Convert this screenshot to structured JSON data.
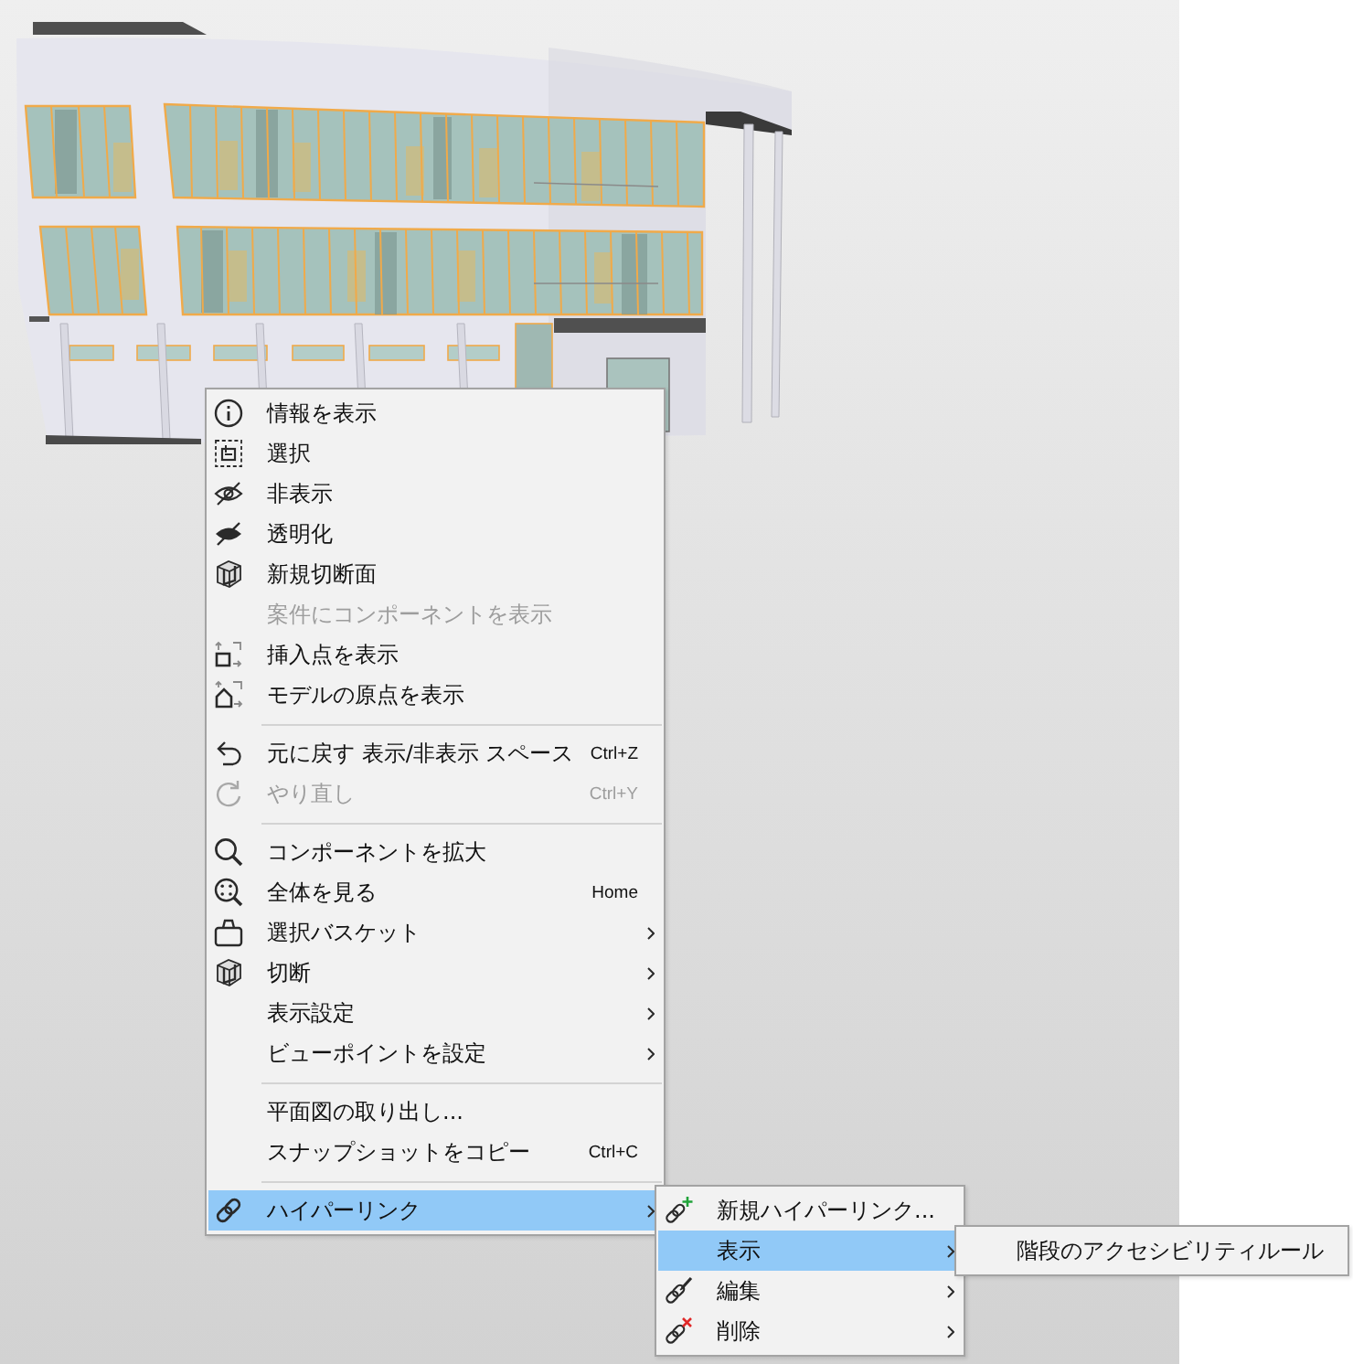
{
  "context_menu": {
    "groups": [
      {
        "items": [
          {
            "label": "情報を表示",
            "disabled": false,
            "selected": false,
            "has_submenu": false
          },
          {
            "label": "選択",
            "disabled": false,
            "selected": false,
            "has_submenu": false
          },
          {
            "label": "非表示",
            "disabled": false,
            "selected": false,
            "has_submenu": false
          },
          {
            "label": "透明化",
            "disabled": false,
            "selected": false,
            "has_submenu": false
          },
          {
            "label": "新規切断面",
            "disabled": false,
            "selected": false,
            "has_submenu": false
          },
          {
            "label": "案件にコンポーネントを表示",
            "disabled": true,
            "selected": false,
            "has_submenu": false
          },
          {
            "label": "挿入点を表示",
            "disabled": false,
            "selected": false,
            "has_submenu": false
          },
          {
            "label": "モデルの原点を表示",
            "disabled": false,
            "selected": false,
            "has_submenu": false
          }
        ]
      },
      {
        "items": [
          {
            "label": "元に戻す 表示/非表示 スペース",
            "shortcut": "Ctrl+Z",
            "disabled": false,
            "selected": false,
            "has_submenu": false
          },
          {
            "label": "やり直し",
            "shortcut": "Ctrl+Y",
            "disabled": true,
            "selected": false,
            "has_submenu": false
          }
        ]
      },
      {
        "items": [
          {
            "label": "コンポーネントを拡大",
            "disabled": false,
            "selected": false,
            "has_submenu": false
          },
          {
            "label": "全体を見る",
            "shortcut": "Home",
            "disabled": false,
            "selected": false,
            "has_submenu": false
          },
          {
            "label": "選択バスケット",
            "disabled": false,
            "selected": false,
            "has_submenu": true
          },
          {
            "label": "切断",
            "disabled": false,
            "selected": false,
            "has_submenu": true
          },
          {
            "label": "表示設定",
            "disabled": false,
            "selected": false,
            "has_submenu": true
          },
          {
            "label": "ビューポイントを設定",
            "disabled": false,
            "selected": false,
            "has_submenu": true
          }
        ]
      },
      {
        "items": [
          {
            "label": "平面図の取り出し...",
            "disabled": false,
            "selected": false,
            "has_submenu": false
          },
          {
            "label": "スナップショットをコピー",
            "shortcut": "Ctrl+C",
            "disabled": false,
            "selected": false,
            "has_submenu": false
          }
        ]
      },
      {
        "items": [
          {
            "label": "ハイパーリンク",
            "disabled": false,
            "selected": true,
            "has_submenu": true,
            "submenu": {
              "items": [
                {
                  "label": "新規ハイパーリンク...",
                  "disabled": false,
                  "selected": false,
                  "has_submenu": false
                },
                {
                  "label": "表示",
                  "disabled": false,
                  "selected": true,
                  "has_submenu": true,
                  "submenu": {
                    "items": [
                      {
                        "label": "階段のアクセシビリティルール",
                        "disabled": false,
                        "selected": false,
                        "has_submenu": false
                      }
                    ]
                  }
                },
                {
                  "label": "編集",
                  "disabled": false,
                  "selected": false,
                  "has_submenu": true
                },
                {
                  "label": "削除",
                  "disabled": false,
                  "selected": false,
                  "has_submenu": true
                }
              ]
            }
          }
        ]
      }
    ]
  }
}
